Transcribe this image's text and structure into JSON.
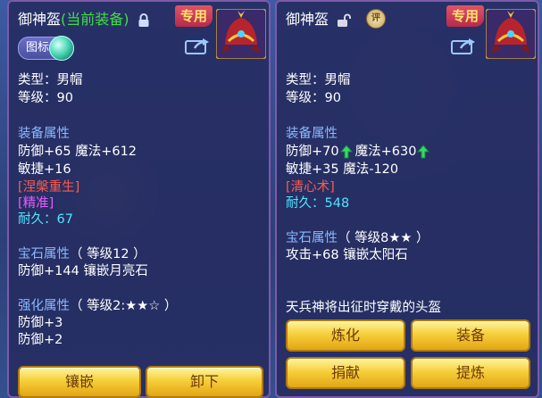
{
  "left": {
    "title_name": "御神盔",
    "title_status": "(当前装备)",
    "exclusive_badge": "专用",
    "chip_label": "图标",
    "type_line": "类型：男帽",
    "level_line": "等级：90",
    "equip_attr_header": "装备属性",
    "attr_line1": "防御+65 魔法+612",
    "attr_line2": "敏捷+16",
    "special1": "[涅槃重生]",
    "special2": "[精准]",
    "durability_label": "耐久：",
    "durability_value": "67",
    "gem_header": "宝石属性",
    "gem_level": "（ 等级12 ）",
    "gem_line": "防御+144 镶嵌月亮石",
    "enhance_header": "强化属性",
    "enhance_level": "（ 等级2:★★☆ ）",
    "enhance_line1": "防御+3",
    "enhance_line2": "防御+2",
    "btn_inlay": "镶嵌",
    "btn_unequip": "卸下"
  },
  "right": {
    "title_name": "御神盔",
    "coin_label": "评",
    "exclusive_badge": "专用",
    "type_line": "类型：男帽",
    "level_line": "等级：90",
    "equip_attr_header": "装备属性",
    "attr_def": "防御+70",
    "attr_magic": "魔法+630",
    "attr_line2": "敏捷+35 魔法-120",
    "special1": "[清心术]",
    "durability_label": "耐久：",
    "durability_value": "548",
    "gem_header": "宝石属性",
    "gem_level": "（ 等级8★★ ）",
    "gem_line": "攻击+68 镶嵌太阳石",
    "description": "天兵神将出征时穿戴的头盔",
    "btn_refine": "炼化",
    "btn_equip": "装备",
    "btn_donate": "捐献",
    "btn_extract": "提炼"
  },
  "colors": {
    "header_blue": "#8ab8ff",
    "equipped_green": "#3fe03f",
    "special_red": "#ff5a4a",
    "special_magenta": "#e85cff",
    "durability_cyan": "#4ee6ff",
    "button_gold": "#f6cf3a"
  },
  "icons": [
    "lock-icon",
    "unlock-icon",
    "share-icon",
    "helmet-icon",
    "orb-icon",
    "up-arrow-icon",
    "appraisal-coin-icon"
  ]
}
